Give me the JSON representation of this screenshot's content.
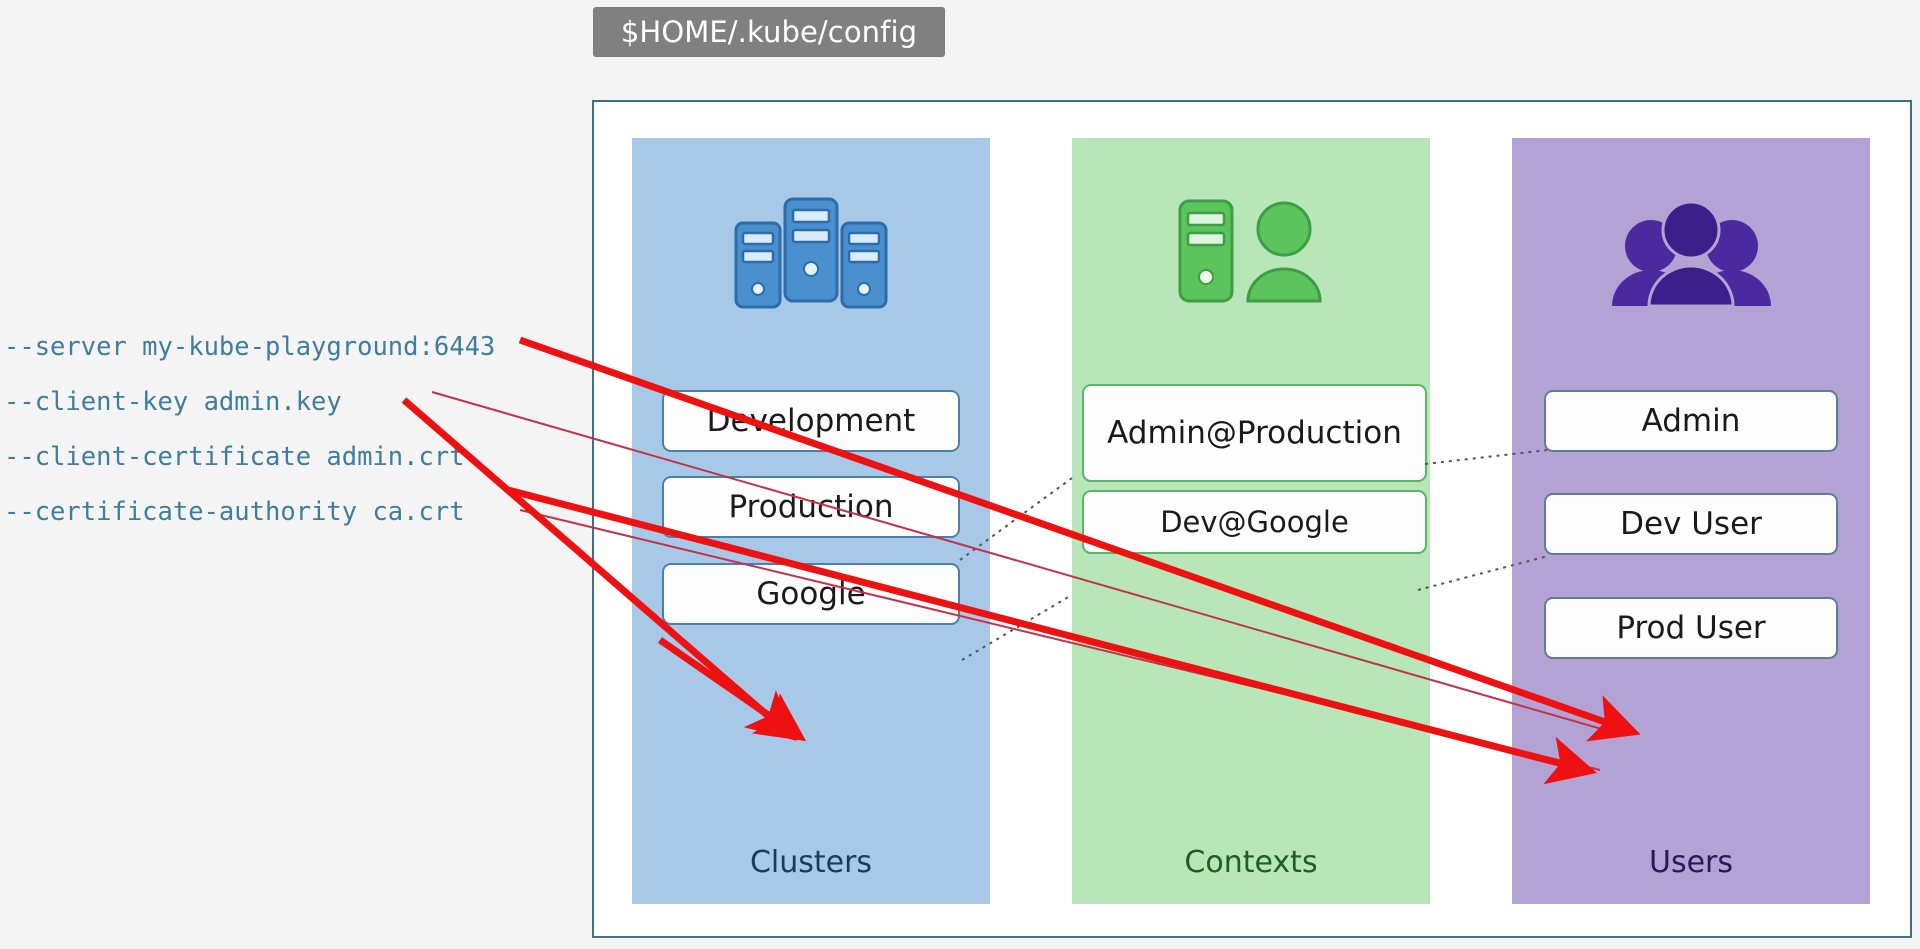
{
  "title": {
    "label": "$HOME/.kube/config",
    "background": "#808080",
    "text_color": "#ffffff"
  },
  "annotations": {
    "flag_lines": [
      "--server my-kube-playground:6443",
      "--client-key admin.key",
      "--client-certificate admin.crt",
      "--certificate-authority ca.crt"
    ],
    "flag_text_color": "#3f7d9e",
    "arrow_color": "#ee1111",
    "thin_line_color": "#c0334a",
    "connector_color": "#555555"
  },
  "panel": {
    "border_color": "#3f6f8f",
    "background": "#ffffff",
    "columns": [
      {
        "key": "clusters",
        "footer_label": "Clusters",
        "background": "#a8c8e8",
        "text_color": "#1b3a5c",
        "icon": "servers-icon",
        "items": [
          {
            "label": "Development"
          },
          {
            "label": "Production"
          },
          {
            "label": "Google"
          }
        ]
      },
      {
        "key": "contexts",
        "footer_label": "Contexts",
        "background": "#b8e6b8",
        "text_color": "#1d5e25",
        "icon": "server-user-icon",
        "items": [
          {
            "label": "Admin@Production"
          },
          {
            "label": "Dev@Google"
          }
        ]
      },
      {
        "key": "users",
        "footer_label": "Users",
        "background": "#b3a3d4",
        "text_color": "#2b1659",
        "icon": "users-group-icon",
        "items": [
          {
            "label": "Admin"
          },
          {
            "label": "Dev User"
          },
          {
            "label": "Prod User"
          }
        ]
      }
    ]
  }
}
